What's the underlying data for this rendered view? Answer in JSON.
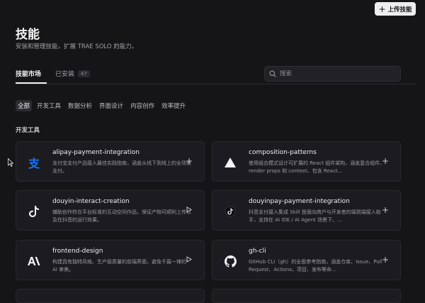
{
  "header": {
    "upload_label": "上传技能",
    "title": "技能",
    "subtitle": "安装和管理技能，扩展 TRAE SOLO 的能力。"
  },
  "tabs": {
    "market": "技能市场",
    "installed": "已安装",
    "installed_count": "47"
  },
  "search": {
    "placeholder": "搜索"
  },
  "filters": [
    "全部",
    "开发工具",
    "数据分析",
    "界面设计",
    "内容创作",
    "效率提升"
  ],
  "section_title": "开发工具",
  "cards": [
    {
      "name": "alipay-payment-integration",
      "desc": "支付宝支付产品接入最佳实践指南，涵盖从线下到线上的全场景支付。",
      "icon": "alipay-icon",
      "action": "add-icon"
    },
    {
      "name": "composition-patterns",
      "desc": "使用组合模式设计可扩展的 React 组件架构，涵盖复合组件、render props 和 context、包含 React…",
      "icon": "vercel-triangle-icon",
      "action": "add-icon"
    },
    {
      "name": "douyin-interact-creation",
      "desc": "辅助创作符合平台标准的互动空间作品，保证产物可顺利上传以及在抖音的运行效果。",
      "icon": "tiktok-icon",
      "action": "play-icon"
    },
    {
      "name": "douyinpay-payment-integration",
      "desc": "抖音支付接入集成 Skill 是面向商户与开发者的端到端接入助手，支持在 AI IDE / AI Agent 场景下、…",
      "icon": "douyinpay-icon",
      "action": "add-icon"
    },
    {
      "name": "frontend-design",
      "desc": "构建具有独特风格、生产级质量的前端界面，避免千篇一律的 AI 审美。",
      "icon": "anthropic-icon",
      "action": "play-icon"
    },
    {
      "name": "gh-cli",
      "desc": "GitHub CLI（gh）的全面参考指南，涵盖仓库、Issue、Pull Request、Actions、项目、发布等命…",
      "icon": "github-icon",
      "action": "add-icon"
    }
  ],
  "colors": {
    "background": "#151518",
    "card": "#1c1c20",
    "alipay_blue": "#1677ff"
  }
}
